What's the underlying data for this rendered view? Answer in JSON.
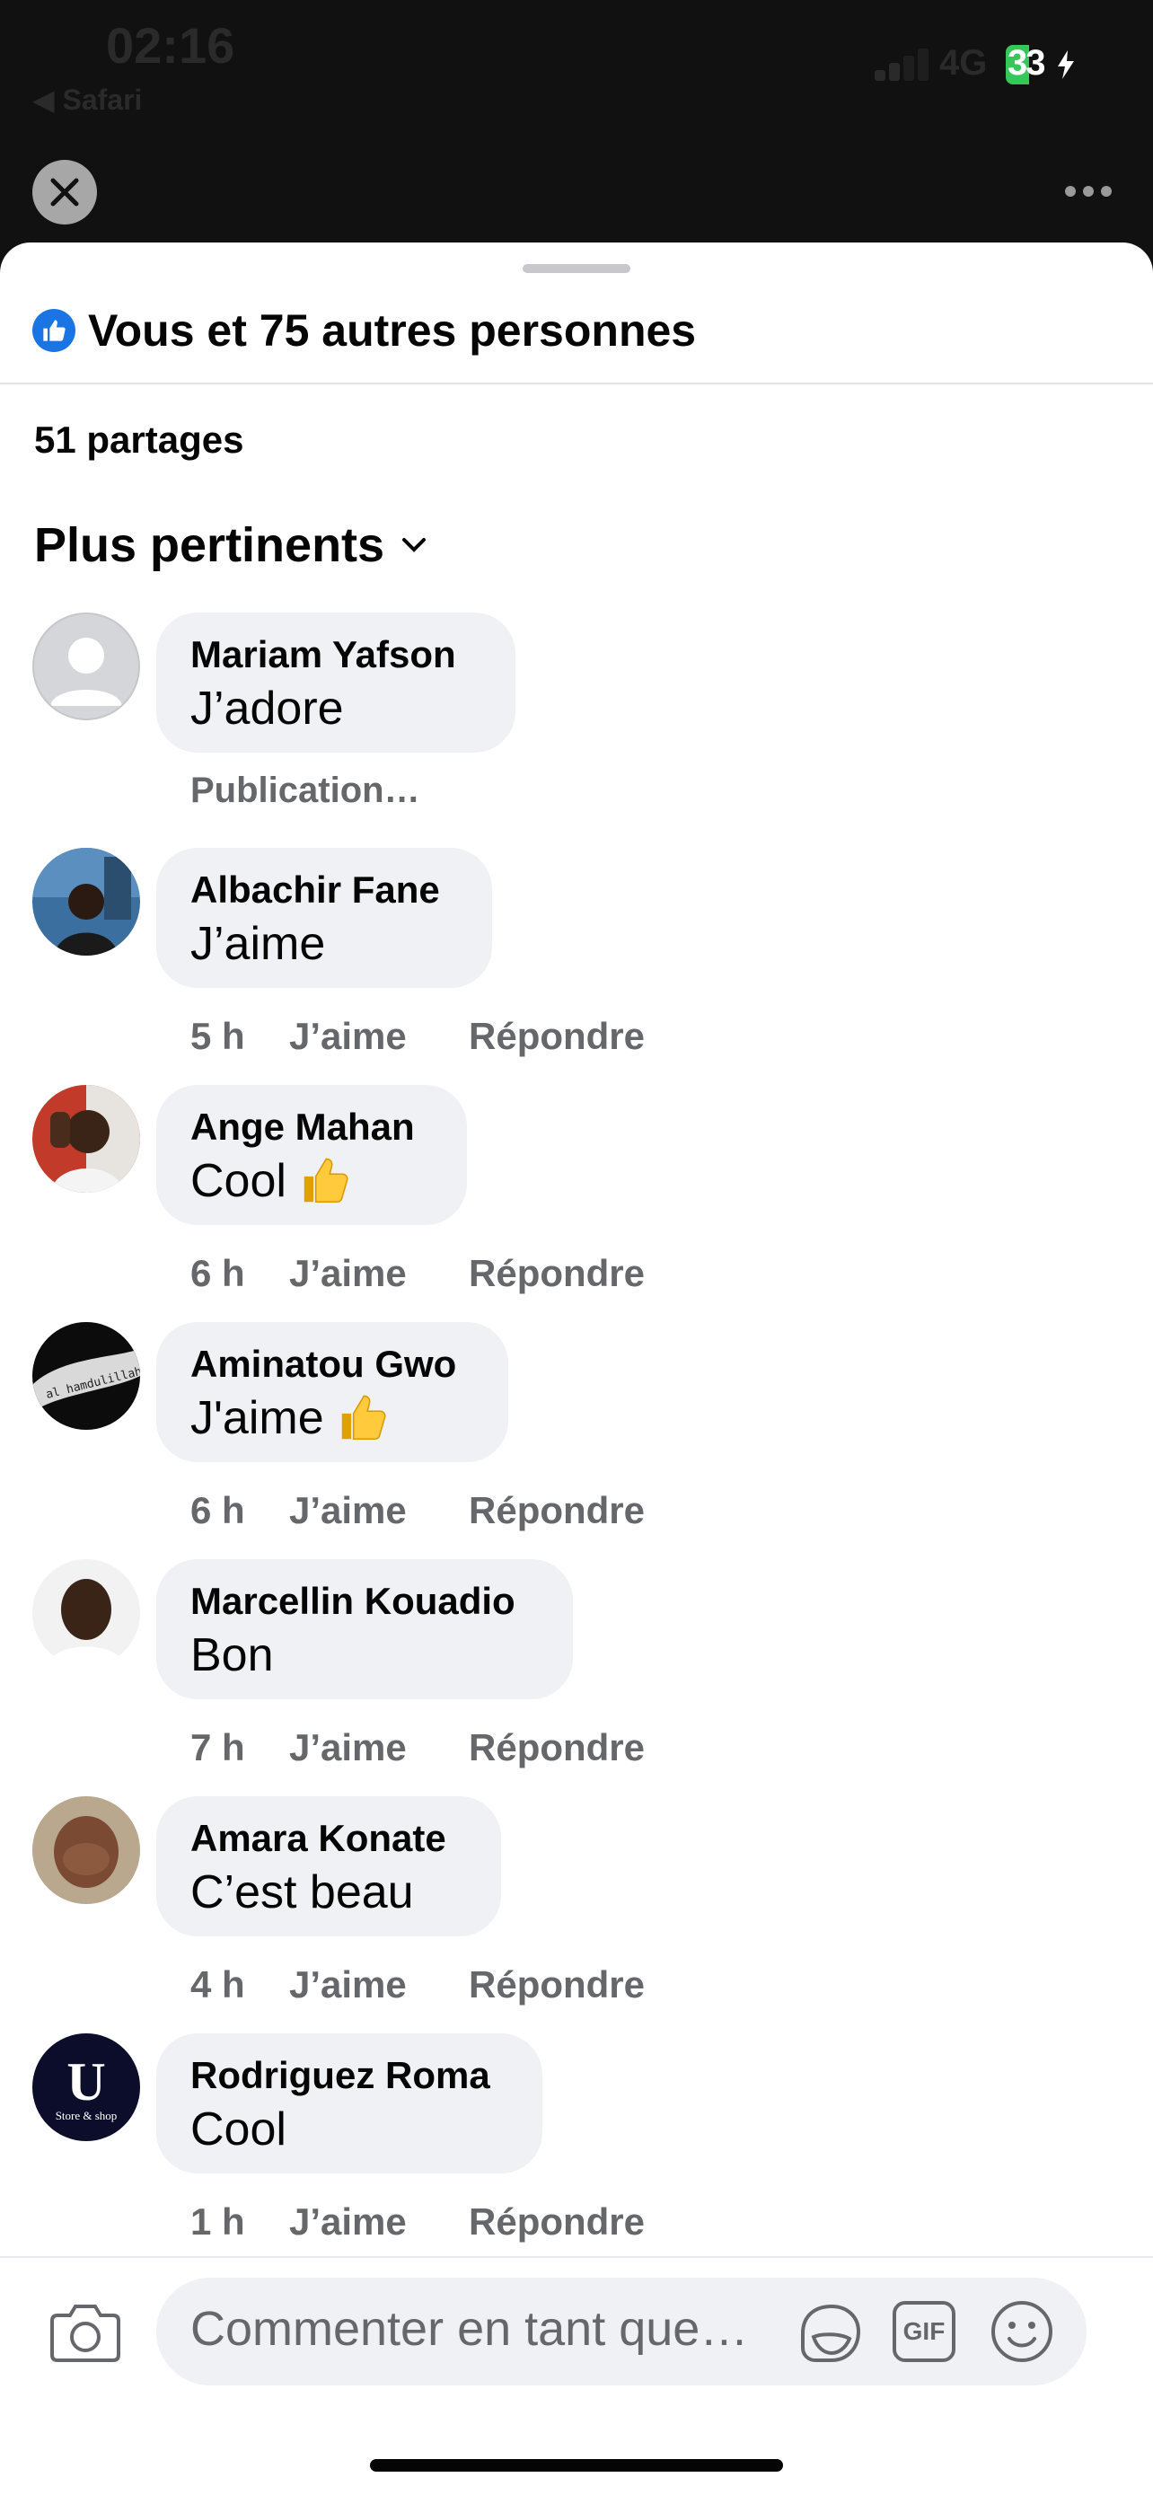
{
  "status_bar": {
    "time": "02:16",
    "back_app": "◀ Safari",
    "network": "4G",
    "battery": "33"
  },
  "header": {
    "reactions_text": "Vous et 75 autres personnes",
    "shares": "51 partages",
    "sort_label": "Plus pertinents"
  },
  "comments": [
    {
      "author": "Mariam Yafson",
      "text": "J’adore",
      "pending": "Publication…",
      "avatar_icon": "default-avatar-icon"
    },
    {
      "author": "Albachir Fane",
      "text": "J’aime",
      "time": "5 h",
      "like": "J’aime",
      "reply": "Répondre"
    },
    {
      "author": "Ange Mahan",
      "text": "Cool",
      "emoji": "thumbs-up-icon",
      "time": "6 h",
      "like": "J’aime",
      "reply": "Répondre"
    },
    {
      "author": "Aminatou Gwo",
      "text": "J'aime",
      "emoji": "thumbs-up-icon",
      "time": "6 h",
      "like": "J’aime",
      "reply": "Répondre",
      "avatar_text": "al hamdulillah"
    },
    {
      "author": "Marcellin Kouadio",
      "text": "Bon",
      "time": "7 h",
      "like": "J’aime",
      "reply": "Répondre"
    },
    {
      "author": "Amara Konate",
      "text": "C’est beau",
      "time": "4 h",
      "like": "J’aime",
      "reply": "Répondre"
    },
    {
      "author": "Rodriguez Roma",
      "text": "Cool",
      "time": "1 h",
      "like": "J’aime",
      "reply": "Répondre",
      "avatar_letter": "U",
      "avatar_caption": "Store & shop"
    }
  ],
  "composer": {
    "placeholder": "Commenter en tant que…",
    "gif_label": "GIF"
  },
  "colors": {
    "sheet": "#ffffff",
    "overlay": "#111111",
    "bubble": "#f0f1f4",
    "secondary_text": "#65676b",
    "like_blue": "#1b74e4",
    "battery_green": "#34c759"
  }
}
